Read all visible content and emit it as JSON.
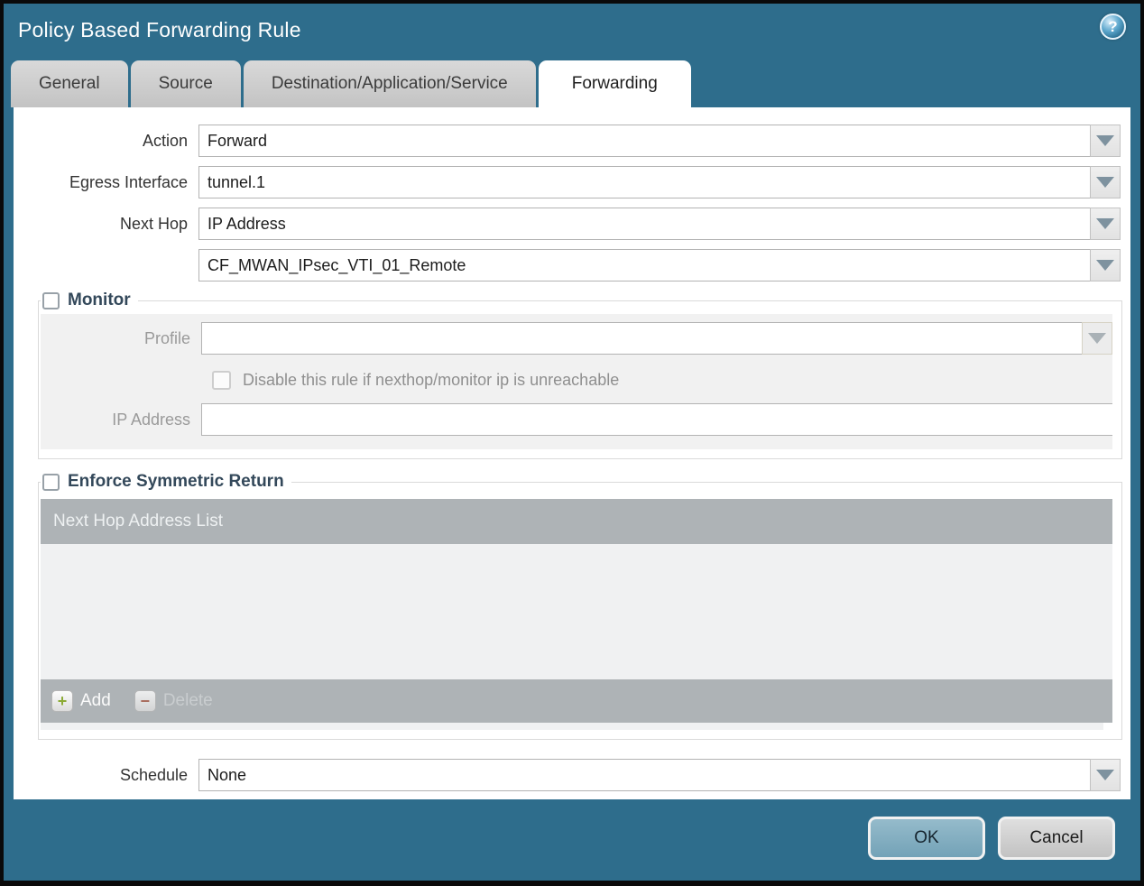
{
  "dialog": {
    "title": "Policy Based Forwarding Rule"
  },
  "icons": {
    "help": "?",
    "add": "+",
    "delete": "−"
  },
  "tabs": [
    {
      "label": "General",
      "active": false
    },
    {
      "label": "Source",
      "active": false
    },
    {
      "label": "Destination/Application/Service",
      "active": false
    },
    {
      "label": "Forwarding",
      "active": true
    }
  ],
  "form": {
    "action": {
      "label": "Action",
      "value": "Forward"
    },
    "egress_interface": {
      "label": "Egress Interface",
      "value": "tunnel.1"
    },
    "next_hop": {
      "label": "Next Hop",
      "type_value": "IP Address",
      "address_value": "CF_MWAN_IPsec_VTI_01_Remote"
    },
    "schedule": {
      "label": "Schedule",
      "value": "None"
    }
  },
  "monitor": {
    "label": "Monitor",
    "checked": false,
    "profile_label": "Profile",
    "profile_value": "",
    "disable_rule_label": "Disable this rule if nexthop/monitor ip is unreachable",
    "disable_rule_checked": false,
    "ip_address_label": "IP Address",
    "ip_address_value": ""
  },
  "symmetric_return": {
    "label": "Enforce Symmetric Return",
    "checked": false,
    "table": {
      "header": "Next Hop Address List",
      "rows": []
    },
    "add_label": "Add",
    "delete_label": "Delete"
  },
  "footer": {
    "ok_label": "OK",
    "cancel_label": "Cancel"
  },
  "colors": {
    "titlebar_teal": "#2e6d8c",
    "active_tab": "#ffffff",
    "inactive_tab": "#c9c9c9",
    "section_label": "#33485a",
    "table_header_gray": "#aeb3b6",
    "disabled_field_beige": "#f0ebdc",
    "add_icon_green": "#8caa35",
    "delete_icon_red": "#a85c49",
    "ok_button_blue": "#7da9bd"
  }
}
